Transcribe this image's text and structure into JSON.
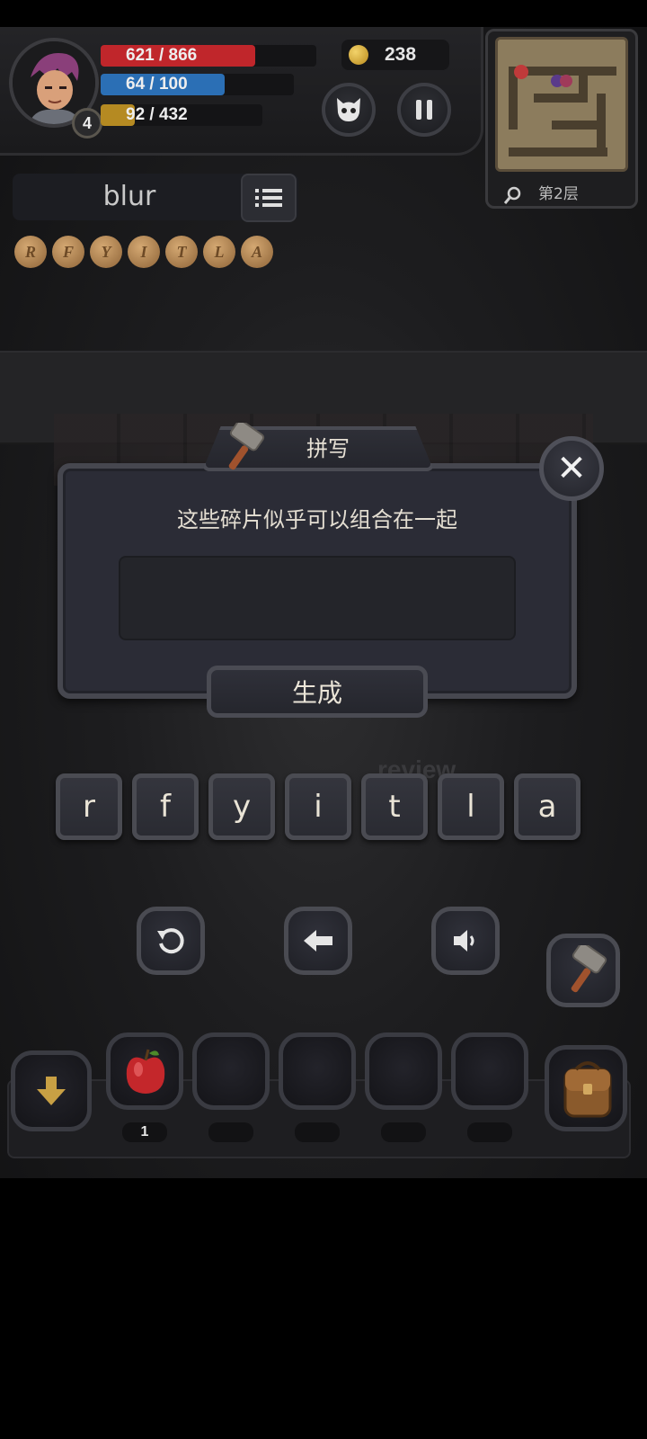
{
  "player": {
    "level": "4",
    "hp_text": "621 / 866",
    "hp_fraction": 0.717,
    "mp_text": "64 / 100",
    "mp_fraction": 0.64,
    "xp_text": "92 / 432",
    "xp_fraction": 0.213
  },
  "coins": "238",
  "minimap": {
    "floor_label": "第2层"
  },
  "word_panel": {
    "word": "blur"
  },
  "runes": [
    "R",
    "F",
    "Y",
    "I",
    "T",
    "L",
    "A"
  ],
  "dialog": {
    "title": "拼写",
    "hint": "这些碎片似乎可以组合在一起",
    "answer": "",
    "generate_label": "生成"
  },
  "letters": [
    "r",
    "f",
    "y",
    "i",
    "t",
    "l",
    "a"
  ],
  "background_text": "review",
  "inventory": {
    "slots": [
      {
        "item": "apple",
        "count": "1"
      },
      {
        "item": "",
        "count": ""
      },
      {
        "item": "",
        "count": ""
      },
      {
        "item": "",
        "count": ""
      },
      {
        "item": "",
        "count": ""
      }
    ]
  },
  "colors": {
    "hp": "#c0262b",
    "mp": "#2b6fb5",
    "xp": "#b58a22",
    "gold": "#e0b54a"
  },
  "icons": {
    "pet": "cat-face-icon",
    "pause": "pause-icon",
    "close": "close-icon",
    "reset": "reset-icon",
    "backspace": "backspace-icon",
    "sound": "speaker-icon",
    "craft": "hammer-icon",
    "drop": "arrow-down-icon",
    "bag": "backpack-icon"
  }
}
